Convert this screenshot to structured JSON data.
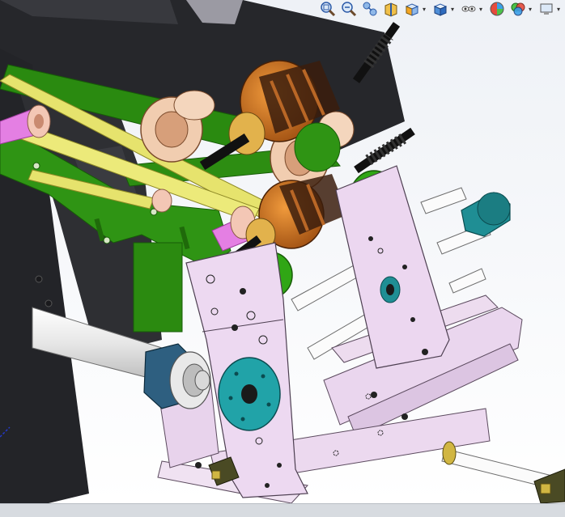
{
  "app": {
    "window_title": ""
  },
  "viewport": {
    "model": "armature-winding-fixture-assembly",
    "colors": {
      "background_top": "#f1f4f8",
      "background_bottom": "#ffffff",
      "frame_dark": "#2a2b2f",
      "green_link": "#2d8a12",
      "yellow_bar": "#e5e26f",
      "magenta_pin": "#e27ae0",
      "lilac_plate": "#ecd9ef",
      "teal_part": "#1f8e94",
      "copper": "#c46b1e",
      "bronze_bushing": "#f2cfb0",
      "rail_white": "#fafafa"
    }
  },
  "hud_toolbar": {
    "items": [
      {
        "name": "zoom-to-fit-icon",
        "caret": false
      },
      {
        "name": "zoom-to-area-icon",
        "caret": false
      },
      {
        "name": "previous-view-icon",
        "caret": false
      },
      {
        "name": "section-view-icon",
        "caret": false
      },
      {
        "name": "view-orientation-icon",
        "caret": true
      },
      {
        "name": "display-style-icon",
        "caret": true
      },
      {
        "name": "hide-show-items-icon",
        "caret": true
      },
      {
        "name": "edit-appearance-icon",
        "caret": false
      },
      {
        "name": "apply-scene-icon",
        "caret": true
      },
      {
        "name": "view-settings-icon",
        "caret": true
      }
    ]
  }
}
